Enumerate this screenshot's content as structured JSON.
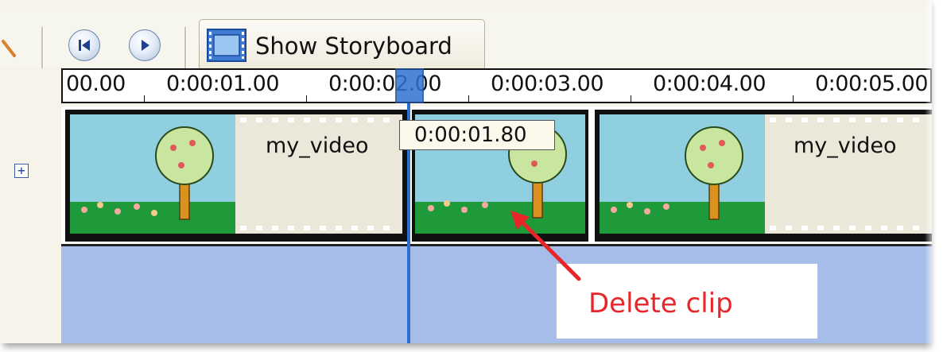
{
  "toolbar": {
    "storyboard_label": "Show Storyboard"
  },
  "timeline": {
    "ticks": [
      "00.00",
      "0:00:01.00",
      "0:00:02.00",
      "0:00:03.00",
      "0:00:04.00",
      "0:00:05.00"
    ],
    "playhead_tooltip": "0:00:01.80",
    "clips": [
      {
        "title": "my_video"
      },
      {
        "title": ""
      },
      {
        "title": "my_video"
      }
    ]
  },
  "callout": {
    "text": "Delete clip"
  },
  "colors": {
    "accent": "#2a6fcf",
    "audio_track": "#a7bde9",
    "callout_text": "#e8262a"
  }
}
